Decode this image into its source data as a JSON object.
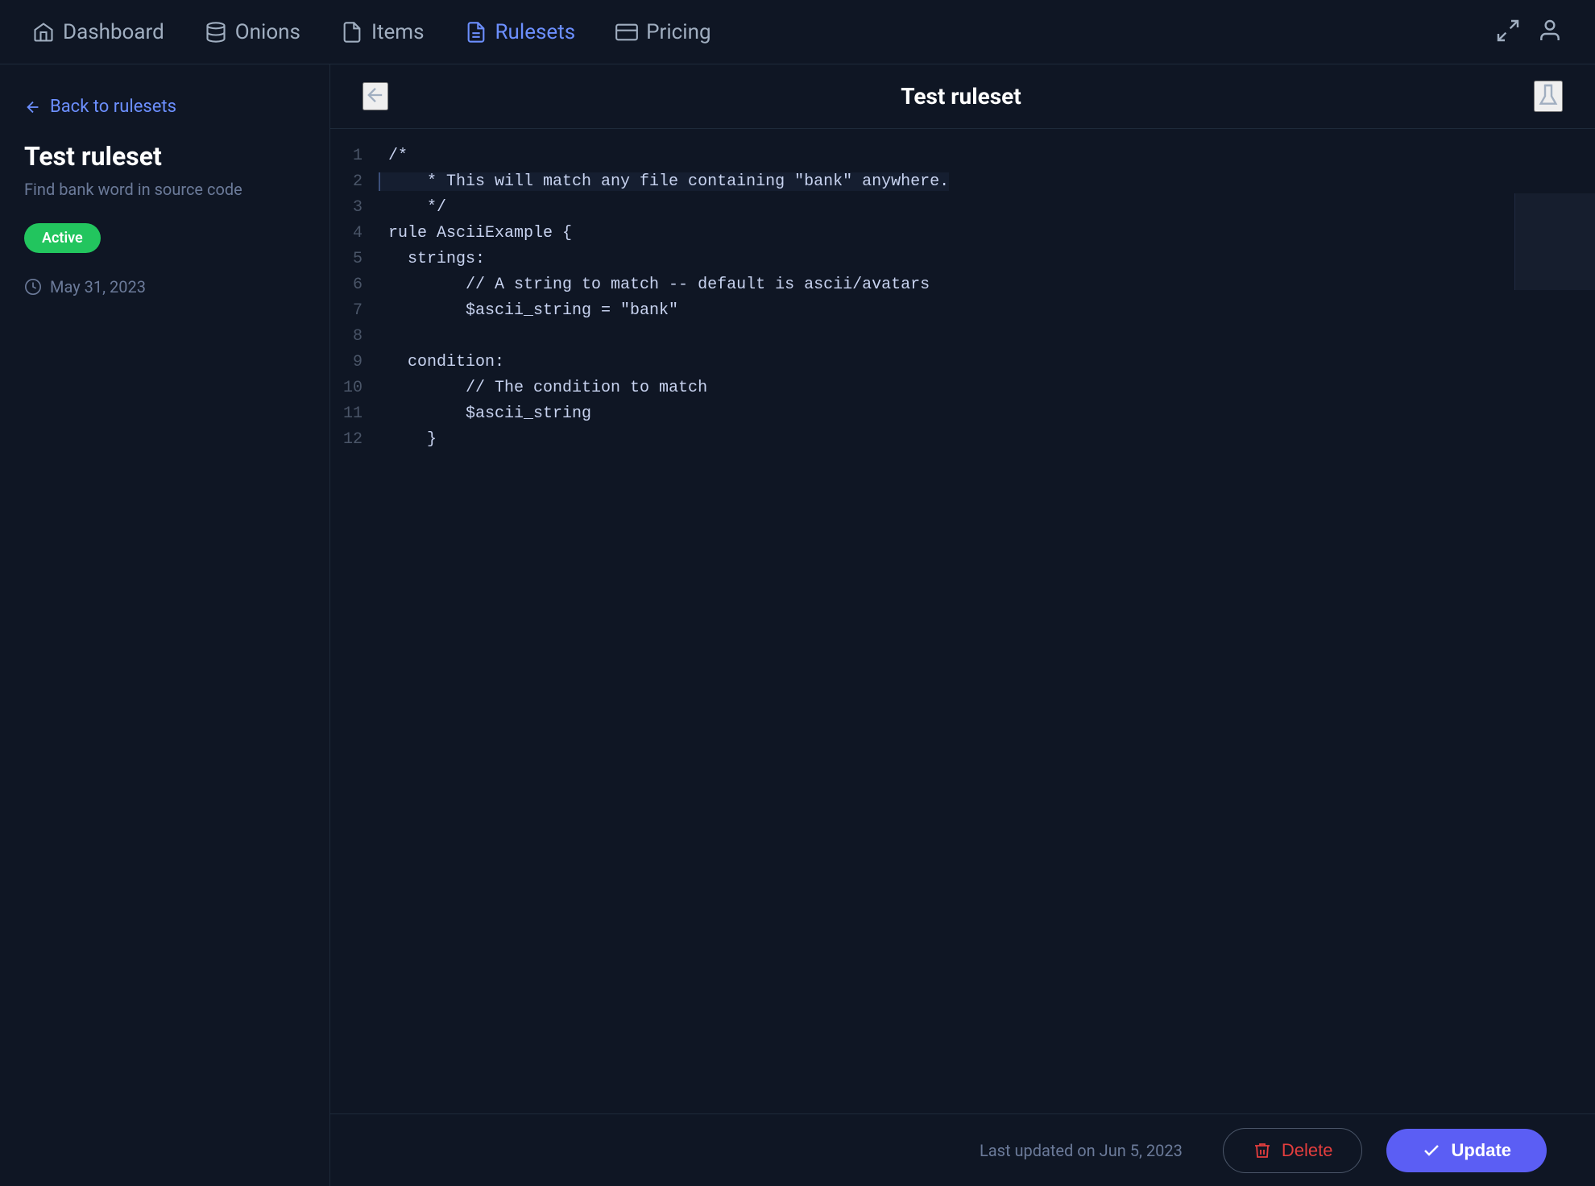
{
  "navbar": {
    "dashboard_label": "Dashboard",
    "onions_label": "Onions",
    "items_label": "Items",
    "rulesets_label": "Rulesets",
    "pricing_label": "Pricing"
  },
  "sidebar": {
    "back_label": "Back to rulesets",
    "title": "Test ruleset",
    "description": "Find bank word in source code",
    "status": "Active",
    "date": "May 31, 2023"
  },
  "content": {
    "header_title": "Test ruleset",
    "code_lines": [
      {
        "num": "1",
        "code": "/*",
        "indent": ""
      },
      {
        "num": "2",
        "code": "    * This will match any file containing \"bank\" anywhere.",
        "indent": "highlight"
      },
      {
        "num": "3",
        "code": "    */",
        "indent": ""
      },
      {
        "num": "4",
        "code": "rule AsciiExample {",
        "indent": ""
      },
      {
        "num": "5",
        "code": "  strings:",
        "indent": ""
      },
      {
        "num": "6",
        "code": "        // A string to match -- default is ascii/avatars",
        "indent": ""
      },
      {
        "num": "7",
        "code": "        $ascii_string = \"bank\"",
        "indent": ""
      },
      {
        "num": "8",
        "code": "",
        "indent": ""
      },
      {
        "num": "9",
        "code": "  condition:",
        "indent": ""
      },
      {
        "num": "10",
        "code": "        // The condition to match",
        "indent": ""
      },
      {
        "num": "11",
        "code": "        $ascii_string",
        "indent": ""
      },
      {
        "num": "12",
        "code": "    }",
        "indent": ""
      }
    ],
    "footer_last_updated": "Last updated on Jun 5, 2023",
    "delete_label": "Delete",
    "update_label": "Update"
  }
}
